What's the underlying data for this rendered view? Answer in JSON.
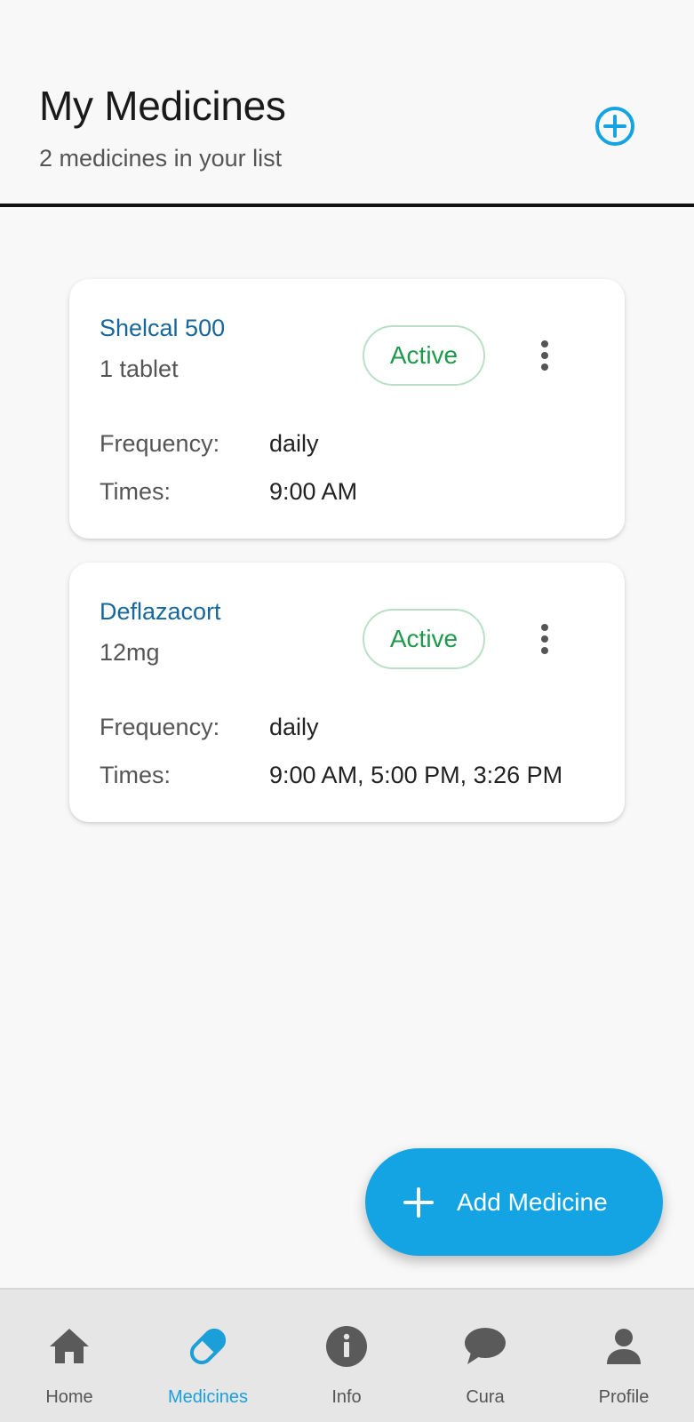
{
  "header": {
    "title": "My Medicines",
    "subtitle": "2 medicines in your list",
    "add_icon": "plus-circle-icon"
  },
  "medicines": [
    {
      "name": "Shelcal 500",
      "dose": "1 tablet",
      "status": "Active",
      "frequency_label": "Frequency:",
      "frequency": "daily",
      "times_label": "Times:",
      "times": "9:00 AM"
    },
    {
      "name": "Deflazacort",
      "dose": "12mg",
      "status": "Active",
      "frequency_label": "Frequency:",
      "frequency": "daily",
      "times_label": "Times:",
      "times": "9:00 AM, 5:00 PM, 3:26 PM"
    }
  ],
  "fab": {
    "label": "Add Medicine",
    "icon": "plus-icon"
  },
  "nav": {
    "active": "Medicines",
    "items": [
      {
        "label": "Home",
        "icon": "home-icon"
      },
      {
        "label": "Medicines",
        "icon": "pill-icon"
      },
      {
        "label": "Info",
        "icon": "info-icon"
      },
      {
        "label": "Cura",
        "icon": "chat-bubble-icon"
      },
      {
        "label": "Profile",
        "icon": "person-icon"
      }
    ]
  },
  "colors": {
    "accent": "#14a4e4",
    "medicine_name": "#17679b",
    "status_active": "#1e9a4a",
    "nav_active": "#1a9fd9"
  }
}
